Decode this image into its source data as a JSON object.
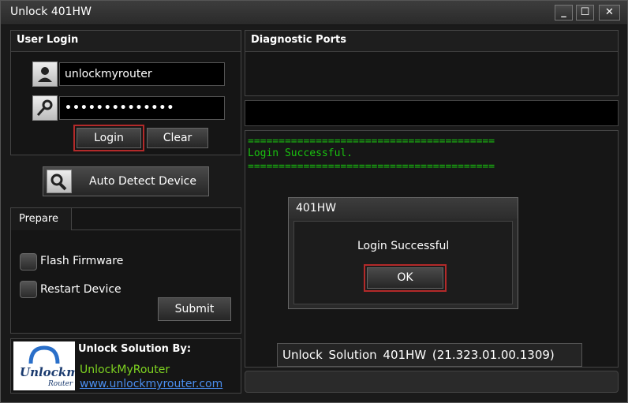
{
  "window": {
    "title": "Unlock 401HW",
    "minimize": "_",
    "maximize": "☐",
    "close": "✕"
  },
  "login_panel": {
    "heading": "User Login",
    "username": "unlockmyrouter",
    "password": "••••••••••••••",
    "login_label": "Login",
    "clear_label": "Clear"
  },
  "auto_detect": {
    "label": "Auto Detect Device"
  },
  "prepare": {
    "tab_label": "Prepare",
    "flash_label": "Flash Firmware",
    "restart_label": "Restart Device",
    "submit_label": "Submit"
  },
  "branding": {
    "logo_text": "Unlockmy",
    "logo_sub": "Router",
    "heading": "Unlock Solution By:",
    "company": "UnlockMyRouter",
    "url": "www.unlockmyrouter.com"
  },
  "diagnostic": {
    "heading": "Diagnostic Ports"
  },
  "log": {
    "separator": "========================================",
    "message": "Login Successful."
  },
  "dialog": {
    "title": "401HW",
    "message": "Login Successful",
    "ok_label": "OK"
  },
  "version": {
    "text": "Unlock Solution 401HW (21.323.01.00.1309)"
  },
  "colors": {
    "accent_red": "#b32a2a",
    "log_green": "#19c20f",
    "link_blue": "#4a8ef0",
    "company_green": "#7ed321"
  }
}
